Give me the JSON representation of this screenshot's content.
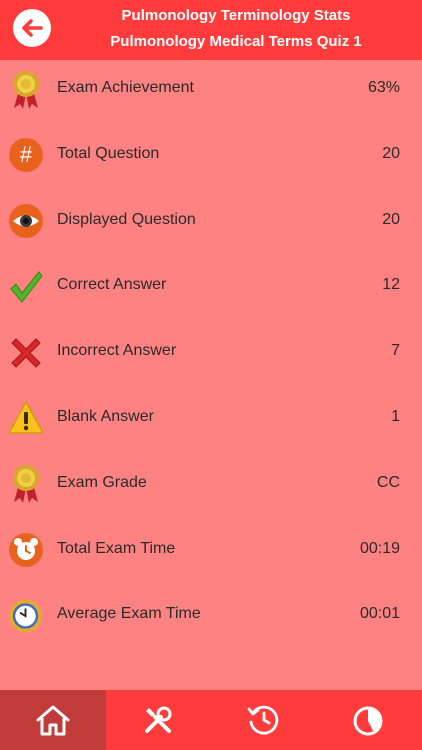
{
  "header": {
    "title": "Pulmonology Terminology Stats",
    "subtitle": "Pulmonology Medical Terms Quiz 1"
  },
  "rows": [
    {
      "icon": "award-medal-icon",
      "label": "Exam Achievement",
      "value": "63%"
    },
    {
      "icon": "hash-icon",
      "label": "Total Question",
      "value": "20"
    },
    {
      "icon": "eye-icon",
      "label": "Displayed Question",
      "value": "20"
    },
    {
      "icon": "checkmark-icon",
      "label": "Correct Answer",
      "value": "12"
    },
    {
      "icon": "x-mark-icon",
      "label": "Incorrect Answer",
      "value": "7"
    },
    {
      "icon": "warning-icon",
      "label": "Blank Answer",
      "value": "1"
    },
    {
      "icon": "award-medal-icon",
      "label": "Exam Grade",
      "value": "CC"
    },
    {
      "icon": "alarm-clock-icon",
      "label": "Total Exam Time",
      "value": "00:19"
    },
    {
      "icon": "clock-icon",
      "label": "Average Exam Time",
      "value": "00:01"
    }
  ],
  "tabs": [
    {
      "icon": "home-icon",
      "active": true
    },
    {
      "icon": "tools-icon",
      "active": false
    },
    {
      "icon": "history-icon",
      "active": false
    },
    {
      "icon": "pie-chart-icon",
      "active": false
    }
  ],
  "colors": {
    "header": "#ff3b3b",
    "background": "#ff8282",
    "active_tab": "#c23b3b"
  }
}
